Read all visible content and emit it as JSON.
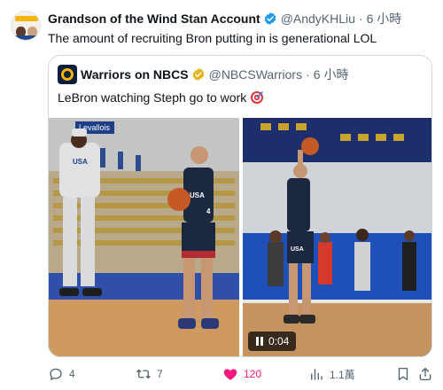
{
  "tweet": {
    "author": {
      "name": "Grandson of the Wind Stan Account",
      "handle": "@AndyKHLiu",
      "time": "6 小時"
    },
    "separator": "·",
    "text": "The amount of recruiting Bron putting in is generational LOL"
  },
  "quote": {
    "author": {
      "name": "Warriors on NBCS",
      "handle": "@NBCSWarriors",
      "time": "6 小時"
    },
    "separator": "·",
    "text": "LeBron watching Steph go to work",
    "media": {
      "left_sign": "Levallois",
      "left_jersey": "USA",
      "left_number": "4",
      "right_jersey": "USA",
      "video_duration": "0:04"
    }
  },
  "actions": {
    "replies": "4",
    "reposts": "7",
    "likes": "120",
    "views": "1.1萬"
  },
  "colors": {
    "like": "#f91880",
    "verified": "#1d9bf0",
    "gold_badge": "#e8b21b",
    "muted": "#536471"
  }
}
